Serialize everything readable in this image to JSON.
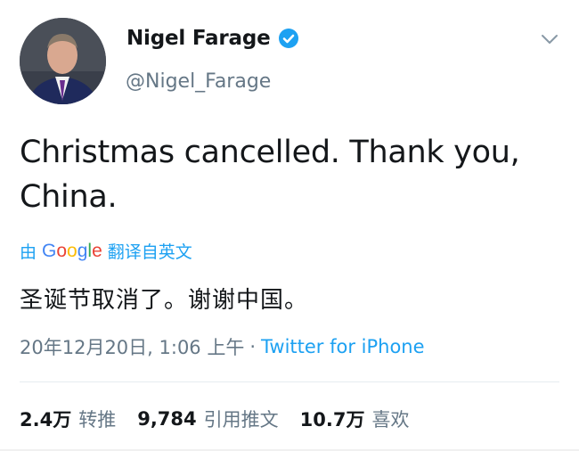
{
  "user": {
    "display_name": "Nigel Farage",
    "handle": "@Nigel_Farage",
    "verified_icon": "verified-badge-icon",
    "avatar_icon": "avatar-photo"
  },
  "tweet": {
    "text_line1": "Christmas cancelled. Thank you,",
    "text_line2": "China."
  },
  "translation": {
    "prefix": "由",
    "google_letters": [
      "G",
      "o",
      "o",
      "g",
      "l",
      "e"
    ],
    "suffix": "翻译自英文",
    "translated_text": "圣诞节取消了。谢谢中国。"
  },
  "meta": {
    "timestamp": "20年12月20日, 1:06 上午",
    "separator": "·",
    "source": "Twitter for iPhone"
  },
  "stats": {
    "retweets_count": "2.4万",
    "retweets_label": "转推",
    "quotes_count": "9,784",
    "quotes_label": "引用推文",
    "likes_count": "10.7万",
    "likes_label": "喜欢"
  },
  "colors": {
    "link_blue": "#1da1f2",
    "secondary_text": "#657786",
    "primary_text": "#14171a",
    "google_blue": "#4285f4",
    "google_red": "#ea4335",
    "google_yellow": "#fbbc05",
    "google_green": "#34a853"
  }
}
